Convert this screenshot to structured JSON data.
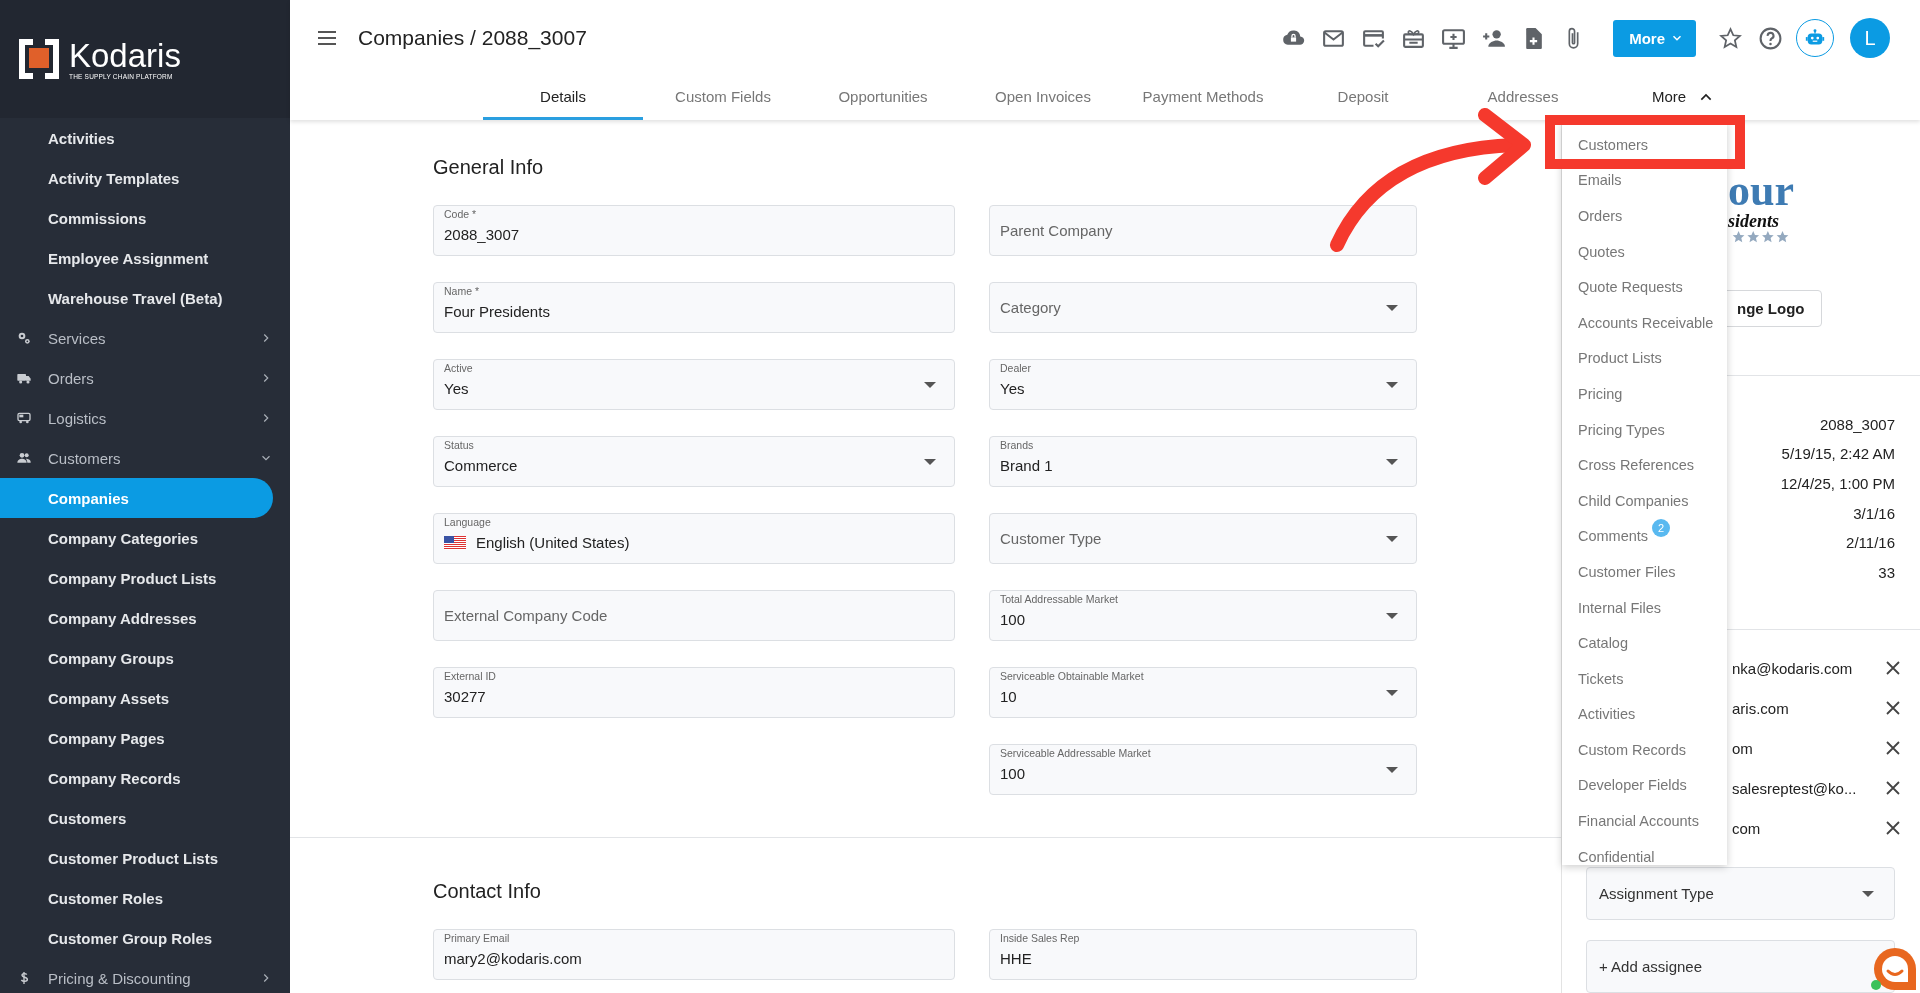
{
  "brand": {
    "name": "Kodaris",
    "tagline": "THE SUPPLY CHAIN PLATFORM"
  },
  "sidebar": {
    "items": [
      {
        "label": "Activities",
        "kind": "link",
        "selected": false
      },
      {
        "label": "Activity Templates",
        "kind": "link",
        "selected": false
      },
      {
        "label": "Commissions",
        "kind": "link",
        "selected": false
      },
      {
        "label": "Employee Assignment",
        "kind": "link",
        "selected": false
      },
      {
        "label": "Warehouse Travel (Beta)",
        "kind": "link",
        "selected": false
      },
      {
        "label": "Services",
        "kind": "group",
        "selected": false,
        "expanded": false
      },
      {
        "label": "Orders",
        "kind": "group",
        "selected": false,
        "expanded": false
      },
      {
        "label": "Logistics",
        "kind": "group",
        "selected": false,
        "expanded": false
      },
      {
        "label": "Customers",
        "kind": "group",
        "selected": false,
        "expanded": true
      },
      {
        "label": "Companies",
        "kind": "link",
        "selected": true
      },
      {
        "label": "Company Categories",
        "kind": "link",
        "selected": false
      },
      {
        "label": "Company Product Lists",
        "kind": "link",
        "selected": false
      },
      {
        "label": "Company Addresses",
        "kind": "link",
        "selected": false
      },
      {
        "label": "Company Groups",
        "kind": "link",
        "selected": false
      },
      {
        "label": "Company Assets",
        "kind": "link",
        "selected": false
      },
      {
        "label": "Company Pages",
        "kind": "link",
        "selected": false
      },
      {
        "label": "Company Records",
        "kind": "link",
        "selected": false
      },
      {
        "label": "Customers",
        "kind": "link",
        "selected": false
      },
      {
        "label": "Customer Product Lists",
        "kind": "link",
        "selected": false
      },
      {
        "label": "Customer Roles",
        "kind": "link",
        "selected": false
      },
      {
        "label": "Customer Group Roles",
        "kind": "link",
        "selected": false
      },
      {
        "label": "Pricing & Discounting",
        "kind": "group",
        "selected": false,
        "expanded": false
      }
    ]
  },
  "header": {
    "title": "Companies / 2088_3007",
    "more_button": "More",
    "avatar": "L",
    "tabs": [
      {
        "label": "Details",
        "selected": true
      },
      {
        "label": "Custom Fields",
        "selected": false
      },
      {
        "label": "Opportunities",
        "selected": false
      },
      {
        "label": "Open Invoices",
        "selected": false
      },
      {
        "label": "Payment Methods",
        "selected": false
      },
      {
        "label": "Deposit",
        "selected": false
      },
      {
        "label": "Addresses",
        "selected": false
      }
    ],
    "more_tab": {
      "label": "More",
      "selected": false,
      "expanded": true
    }
  },
  "more_menu": {
    "items": [
      {
        "label": "Customers"
      },
      {
        "label": "Emails"
      },
      {
        "label": "Orders"
      },
      {
        "label": "Quotes"
      },
      {
        "label": "Quote Requests"
      },
      {
        "label": "Accounts Receivable"
      },
      {
        "label": "Product Lists"
      },
      {
        "label": "Pricing"
      },
      {
        "label": "Pricing Types"
      },
      {
        "label": "Cross References"
      },
      {
        "label": "Child Companies"
      },
      {
        "label": "Comments",
        "badge": "2"
      },
      {
        "label": "Customer Files"
      },
      {
        "label": "Internal Files"
      },
      {
        "label": "Catalog"
      },
      {
        "label": "Tickets"
      },
      {
        "label": "Activities"
      },
      {
        "label": "Custom Records"
      },
      {
        "label": "Developer Fields"
      },
      {
        "label": "Financial Accounts"
      },
      {
        "label": "Confidential"
      }
    ]
  },
  "general_info": {
    "title": "General Info",
    "left": [
      {
        "kind": "text",
        "label": "Code *",
        "value": "2088_3007"
      },
      {
        "kind": "text",
        "label": "Name *",
        "value": "Four Presidents"
      },
      {
        "kind": "select",
        "label": "Active",
        "value": "Yes"
      },
      {
        "kind": "select",
        "label": "Status",
        "value": "Commerce"
      },
      {
        "kind": "language",
        "label": "Language",
        "value": "English (United States)"
      },
      {
        "kind": "text",
        "placeholder": "External Company Code"
      },
      {
        "kind": "text",
        "label": "External ID",
        "value": "30277"
      }
    ],
    "right": [
      {
        "kind": "text",
        "placeholder": "Parent Company"
      },
      {
        "kind": "select",
        "placeholder": "Category"
      },
      {
        "kind": "select",
        "label": "Dealer",
        "value": "Yes"
      },
      {
        "kind": "select",
        "label": "Brands",
        "value": "Brand 1"
      },
      {
        "kind": "select",
        "placeholder": "Customer Type"
      },
      {
        "kind": "select",
        "label": "Total Addressable Market",
        "value": "100"
      },
      {
        "kind": "select",
        "label": "Serviceable Obtainable Market",
        "value": "10"
      },
      {
        "kind": "select",
        "label": "Serviceable Addressable Market",
        "value": "100"
      }
    ]
  },
  "contact_info": {
    "title": "Contact Info",
    "left": [
      {
        "kind": "text",
        "label": "Primary Email",
        "value": "mary2@kodaris.com"
      }
    ],
    "right": [
      {
        "kind": "text",
        "label": "Inside Sales Rep",
        "value": "HHE"
      }
    ]
  },
  "company_panel": {
    "logo_text": [
      "our",
      "sidents"
    ],
    "change_logo_button": "nge Logo",
    "details": [
      "2088_3007",
      "5/19/15, 2:42 AM",
      "12/4/25, 1:00 PM",
      "3/1/16",
      "2/11/16",
      "33"
    ],
    "emails": [
      "nka@kodaris.com",
      "aris.com",
      "om",
      "salesreptest@ko...",
      "com"
    ],
    "assignment_type": {
      "placeholder": "Assignment Type"
    },
    "add_assignee": "+ Add assignee"
  }
}
